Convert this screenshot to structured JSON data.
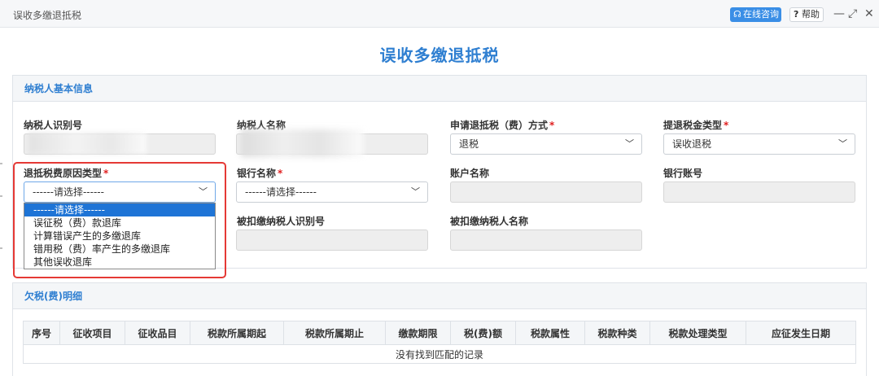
{
  "window": {
    "title": "误收多缴退抵税",
    "consult_label": "在线咨询",
    "help_label": "帮助",
    "minimize": "—",
    "restore": "⤢",
    "close": "✕"
  },
  "page_title": "误收多缴退抵税",
  "basic_info": {
    "section_title": "纳税人基本信息",
    "taxpayer_id": {
      "label": "纳税人识别号",
      "value": ""
    },
    "taxpayer_name": {
      "label": "纳税人名称",
      "value": ""
    },
    "refund_method": {
      "label": "申请退抵税（费）方式",
      "required": "*",
      "value": "退税"
    },
    "refund_type": {
      "label": "提退税金类型",
      "required": "*",
      "value": "误收退税"
    },
    "reason_type": {
      "label": "退抵税费原因类型",
      "required": "*",
      "value": "------请选择------",
      "options": [
        "------请选择------",
        "误征税（费）款退库",
        "计算错误产生的多缴退库",
        "错用税（费）率产生的多缴退库",
        "其他误收退库"
      ]
    },
    "bank_name": {
      "label": "银行名称",
      "required": "*",
      "value": "------请选择------"
    },
    "account_name": {
      "label": "账户名称",
      "value": ""
    },
    "bank_account": {
      "label": "银行账号",
      "value": ""
    },
    "withheld_id": {
      "label": "被扣缴纳税人识别号",
      "value": ""
    },
    "withheld_name": {
      "label": "被扣缴纳税人名称",
      "value": ""
    }
  },
  "arrears": {
    "section_title": "欠税(费)明细",
    "columns": [
      "序号",
      "征收项目",
      "征收品目",
      "税款所属期起",
      "税款所属期止",
      "缴款期限",
      "税(费)额",
      "税款属性",
      "税款种类",
      "税款处理类型",
      "应征发生日期"
    ],
    "empty_text": "没有找到匹配的记录"
  },
  "colors": {
    "accent": "#2f7fd1",
    "highlight": "#e53935",
    "option_selected": "#1e74d6"
  }
}
